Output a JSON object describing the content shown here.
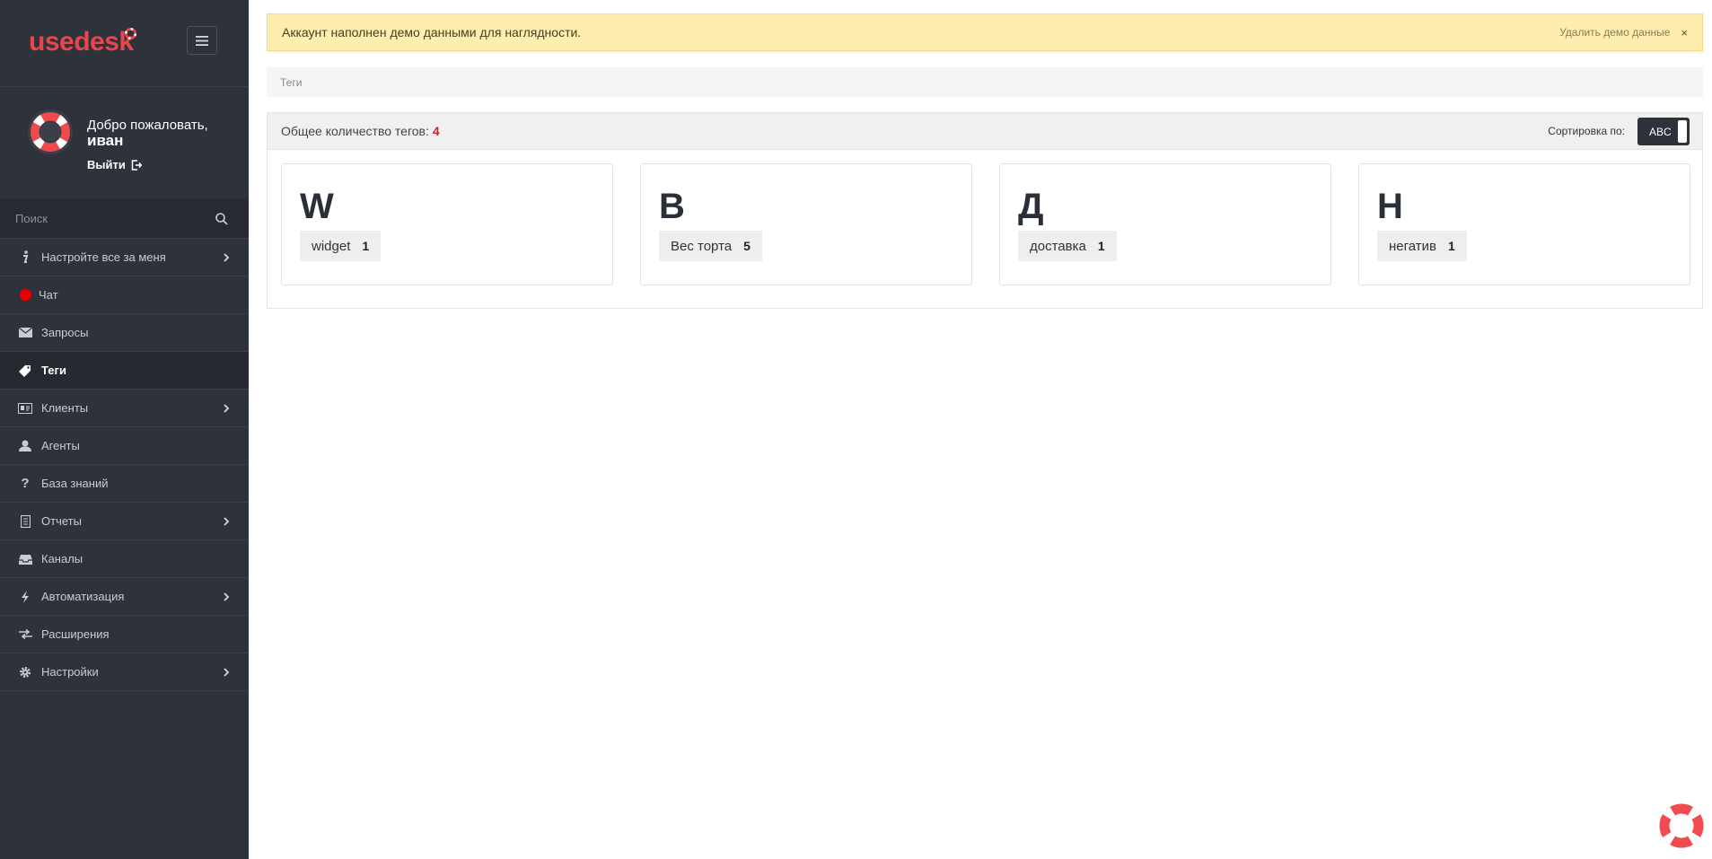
{
  "brand": {
    "logo_text": "usedesk",
    "accent": "#e8454c"
  },
  "user": {
    "greeting": "Добро пожаловать,",
    "name": "иван",
    "logout_label": "Выйти"
  },
  "search": {
    "placeholder": "Поиск"
  },
  "nav": {
    "items": [
      {
        "label": "Настройте все за меня",
        "icon": "info-icon",
        "chevron": true
      },
      {
        "label": "Чат",
        "icon": "status-dot-icon",
        "chevron": false
      },
      {
        "label": "Запросы",
        "icon": "envelope-icon",
        "chevron": false
      },
      {
        "label": "Теги",
        "icon": "tags-icon",
        "chevron": false,
        "active": true
      },
      {
        "label": "Клиенты",
        "icon": "contacts-card-icon",
        "chevron": true
      },
      {
        "label": "Агенты",
        "icon": "user-icon",
        "chevron": false
      },
      {
        "label": "База знаний",
        "icon": "question-icon",
        "chevron": false
      },
      {
        "label": "Отчеты",
        "icon": "report-icon",
        "chevron": true
      },
      {
        "label": "Каналы",
        "icon": "inbox-icon",
        "chevron": false
      },
      {
        "label": "Автоматизация",
        "icon": "bolt-icon",
        "chevron": true
      },
      {
        "label": "Расширения",
        "icon": "transfer-icon",
        "chevron": false
      },
      {
        "label": "Настройки",
        "icon": "gear-icon",
        "chevron": true
      }
    ]
  },
  "alert": {
    "text": "Аккаунт наполнен демо данными для наглядности.",
    "action": "Удалить демо данные",
    "close": "×"
  },
  "breadcrumb": {
    "current": "Теги"
  },
  "tags_panel": {
    "total_label": "Общее количество тегов:",
    "total_count": "4",
    "sort_label": "Сортировка по:",
    "sort_value": "ABC",
    "groups": [
      {
        "letter": "W",
        "tag": "widget",
        "count": "1"
      },
      {
        "letter": "В",
        "tag": "Вес торта",
        "count": "5"
      },
      {
        "letter": "Д",
        "tag": "доставка",
        "count": "1"
      },
      {
        "letter": "Н",
        "tag": "негатив",
        "count": "1"
      }
    ]
  }
}
